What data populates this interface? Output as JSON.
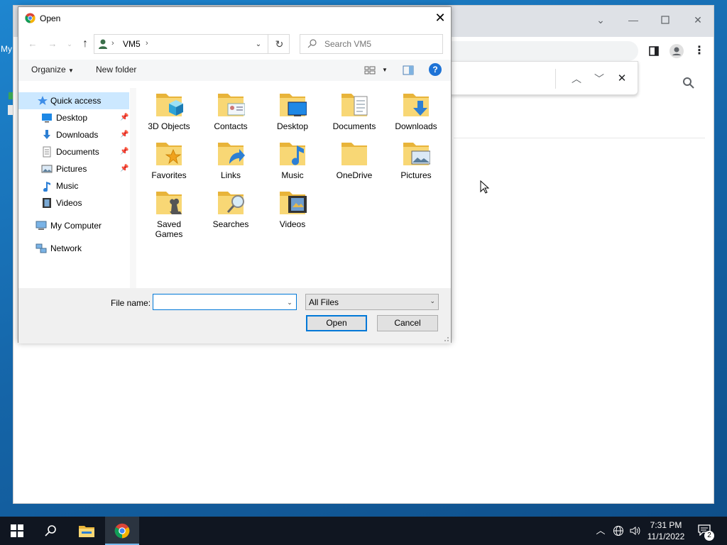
{
  "desktop": {
    "label": "My"
  },
  "dialog": {
    "title": "Open",
    "address": {
      "location": "VM5"
    },
    "search": {
      "placeholder": "Search VM5"
    },
    "toolbar": {
      "organize_label": "Organize",
      "new_folder_label": "New folder",
      "help_label": "?"
    },
    "nav": {
      "items": [
        {
          "label": "Quick access",
          "icon": "star-icon"
        },
        {
          "label": "Desktop",
          "icon": "desktop-icon",
          "pinned": true
        },
        {
          "label": "Downloads",
          "icon": "download-arrow-icon",
          "pinned": true
        },
        {
          "label": "Documents",
          "icon": "document-icon",
          "pinned": true
        },
        {
          "label": "Pictures",
          "icon": "picture-icon",
          "pinned": true
        },
        {
          "label": "Music",
          "icon": "music-note-icon"
        },
        {
          "label": "Videos",
          "icon": "film-icon"
        },
        {
          "label": "My Computer",
          "icon": "computer-icon"
        },
        {
          "label": "Network",
          "icon": "network-icon"
        }
      ]
    },
    "files": [
      {
        "label": "3D Objects",
        "icon": "3d-cube-icon"
      },
      {
        "label": "Contacts",
        "icon": "contact-card-icon"
      },
      {
        "label": "Desktop",
        "icon": "desktop-icon"
      },
      {
        "label": "Documents",
        "icon": "document-icon"
      },
      {
        "label": "Downloads",
        "icon": "download-arrow-icon"
      },
      {
        "label": "Favorites",
        "icon": "star-icon"
      },
      {
        "label": "Links",
        "icon": "link-arrow-icon"
      },
      {
        "label": "Music",
        "icon": "music-note-icon"
      },
      {
        "label": "OneDrive",
        "icon": "folder-icon"
      },
      {
        "label": "Pictures",
        "icon": "picture-icon"
      },
      {
        "label": "Saved Games",
        "label_line1": "Saved",
        "label_line2": "Games",
        "icon": "chess-piece-icon"
      },
      {
        "label": "Searches",
        "icon": "magnifier-icon"
      },
      {
        "label": "Videos",
        "icon": "film-icon"
      }
    ],
    "bottom": {
      "file_name_label": "File name:",
      "file_name_value": "",
      "file_type": "All Files",
      "open_label": "Open",
      "cancel_label": "Cancel"
    }
  },
  "taskbar": {
    "time": "7:31 PM",
    "date": "11/1/2022",
    "notification_count": "2"
  },
  "colors": {
    "accent": "#0078d7",
    "folder_yellow": "#f4c542",
    "selection": "#cce8ff",
    "taskbar": "#101621"
  }
}
